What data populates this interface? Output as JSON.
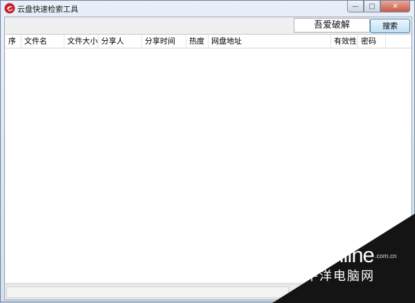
{
  "window": {
    "title": "云盘快速检索工具",
    "minimize_glyph": "—",
    "maximize_glyph": "□",
    "close_glyph": "✕"
  },
  "toolbar": {
    "site_value": "吾爱破解",
    "search_label": "搜索"
  },
  "table": {
    "columns": [
      "序",
      "文件名",
      "文件大小",
      "分享人",
      "分享时间",
      "热度",
      "网盘地址",
      "有效性",
      "密码"
    ],
    "rows": []
  },
  "statusbar": {
    "text": ""
  },
  "watermark": {
    "logo": "PConline",
    "domain": ".com.cn",
    "cn_name": "太平洋电脑网"
  },
  "colors": {
    "accent": "#3c7fb1",
    "titlebar": "#d3dfee",
    "close": "#c75a47",
    "watermark_bg": "#141414"
  }
}
